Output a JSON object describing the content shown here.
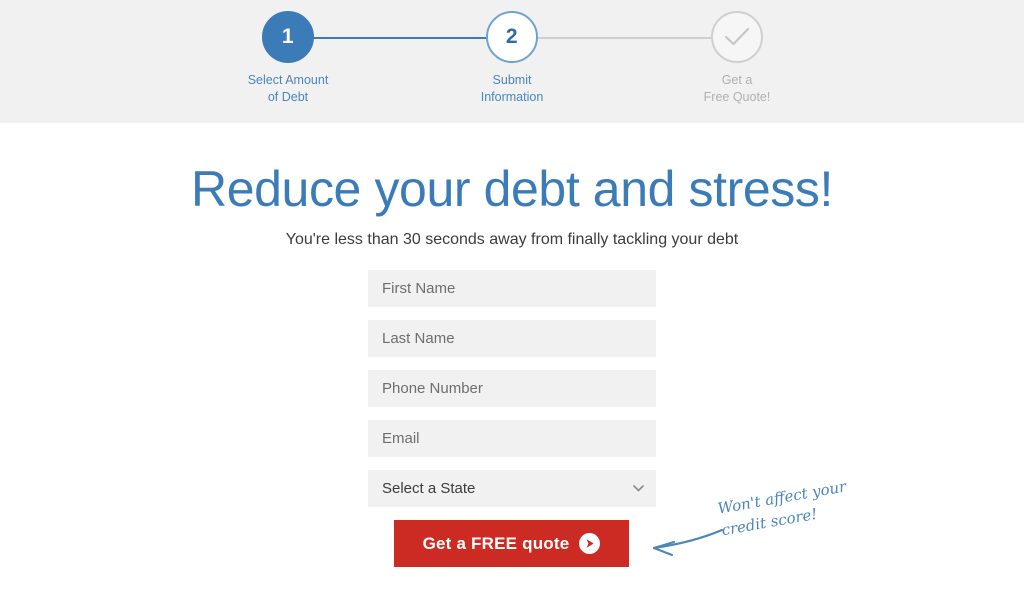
{
  "colors": {
    "brand_blue": "#3b7cb8",
    "step_label_blue": "#4a86bd",
    "muted_gray": "#b0b0b0",
    "band_background": "#f1f1f1",
    "field_background": "#f1f1f1",
    "cta_red": "#cb2b22",
    "page_background": "#ffffff"
  },
  "stepper": {
    "steps": [
      {
        "number": "1",
        "state": "current",
        "label_line1": "Select Amount",
        "label_line2": "of Debt",
        "icon": ""
      },
      {
        "number": "2",
        "state": "upcoming",
        "label_line1": "Submit",
        "label_line2": "Information",
        "icon": ""
      },
      {
        "number": "",
        "state": "disabled",
        "label_line1": "Get a",
        "label_line2": "Free Quote!",
        "icon": "check-icon"
      }
    ]
  },
  "hero": {
    "headline": "Reduce your debt and stress!",
    "subhead": "You're less than 30 seconds away from finally tackling your debt"
  },
  "form": {
    "fields": [
      {
        "name": "first-name-input",
        "placeholder": "First Name",
        "value": ""
      },
      {
        "name": "last-name-input",
        "placeholder": "Last Name",
        "value": ""
      },
      {
        "name": "phone-number-input",
        "placeholder": "Phone Number",
        "value": ""
      },
      {
        "name": "email-input",
        "placeholder": "Email",
        "value": ""
      }
    ],
    "state_select": {
      "selected": "Select a State",
      "options": [
        "Select a State"
      ],
      "icon": "chevron-down-icon"
    },
    "submit": {
      "label": "Get a FREE quote",
      "icon": "arrow-right-circle-icon"
    }
  },
  "annotation": {
    "line1": "Won't affect your",
    "line2": "credit score!",
    "icon": "curved-arrow-left-icon"
  }
}
